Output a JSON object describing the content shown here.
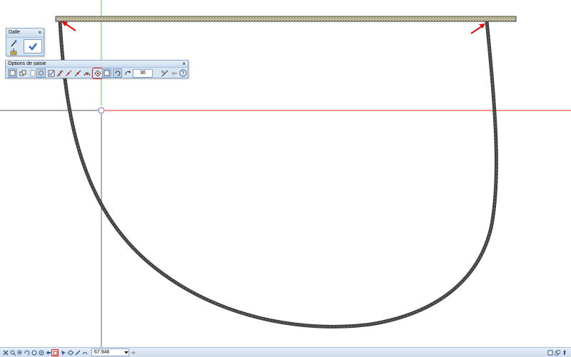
{
  "palette_dalle": {
    "title": "Dalle",
    "close": "×"
  },
  "palette_options": {
    "title": "Options de saisie",
    "close": "×",
    "segments_value": "36"
  },
  "statusbar": {
    "coord_value": "67.946"
  },
  "colors": {
    "canvas_bg": "#ffffff",
    "crosshair_red": "#ff2020",
    "crosshair_green": "#50d050",
    "crosshair_dark": "#444444",
    "wall_outline": "#404040",
    "slab_fill": "#c9c39b",
    "annotation_red": "#e01010",
    "toolbar_bg": "#d7e4f2"
  },
  "icons": {
    "dalle": [
      "pipette-icon",
      "pick-icon",
      "checkmark-ok-icon"
    ],
    "options": [
      "line-input-icon",
      "copy-icon",
      "page-icon",
      "parallel-icon",
      "checkbox-icon",
      "dimension-line-icon",
      "angle-icon",
      "angle2-icon",
      "arc-icon",
      "tangent-arc-icon",
      "polygon-icon",
      "refresh-icon",
      "rotate-icon",
      "scale-icon",
      "back-arrow-icon",
      "help-icon"
    ],
    "status": [
      "cross-icon",
      "zoom-icon",
      "zoom-out-icon",
      "rotate-view-icon",
      "undo-icon",
      "redo-icon",
      "circle-icon",
      "gear-icon",
      "arrow-icon",
      "grid-icon",
      "select-icon",
      "layer-icon",
      "pen-icon",
      "wall-icon",
      "lock-icon",
      "unlock-icon",
      "dropdown-icon",
      "forward-icon"
    ],
    "status_right": [
      "window-icon",
      "layers-icon",
      "pan-icon",
      "pointer-icon"
    ]
  }
}
